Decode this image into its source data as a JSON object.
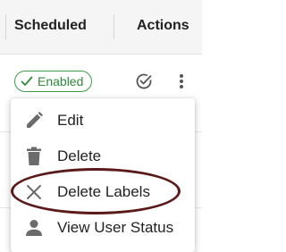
{
  "table": {
    "headers": {
      "scheduled": "Scheduled",
      "actions": "Actions"
    }
  },
  "row": {
    "status_badge": "Enabled",
    "status_icon": "check-icon",
    "action_icons": [
      "check-circle-icon",
      "more-vert-icon"
    ]
  },
  "menu": {
    "items": [
      {
        "label": "Edit",
        "icon": "pencil-icon"
      },
      {
        "label": "Delete",
        "icon": "trash-icon"
      },
      {
        "label": "Delete Labels",
        "icon": "close-icon"
      },
      {
        "label": "View User Status",
        "icon": "person-icon"
      }
    ]
  },
  "colors": {
    "badge_green": "#3d9a48",
    "highlight": "#5a1a1a",
    "icon_gray": "#6b6b6b",
    "header_bg": "#f5f5f5"
  }
}
